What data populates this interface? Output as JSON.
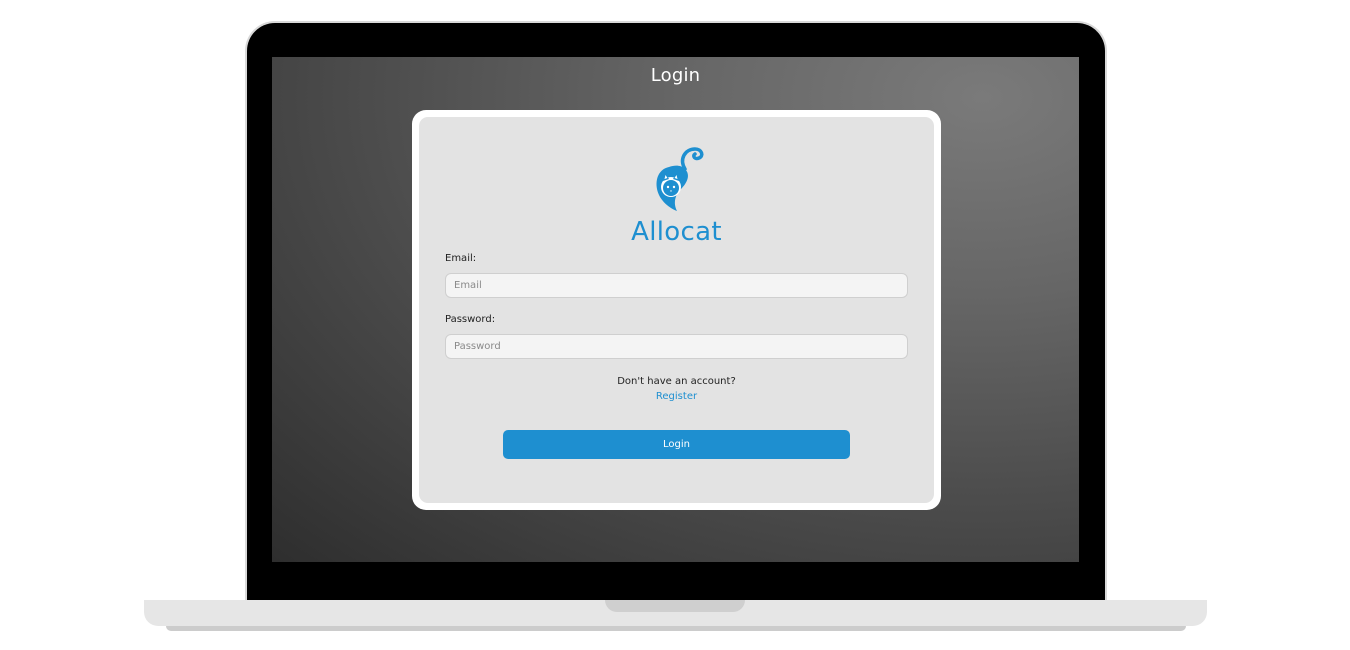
{
  "page": {
    "title": "Login"
  },
  "brand": {
    "name": "Allocat",
    "logo_icon": "cat-logo-icon",
    "color": "#1e8fd0"
  },
  "form": {
    "email_label": "Email:",
    "email_placeholder": "Email",
    "email_value": "",
    "password_label": "Password:",
    "password_placeholder": "Password",
    "password_value": "",
    "no_account_text": "Don't have an account?",
    "register_link": "Register",
    "login_button": "Login"
  },
  "colors": {
    "accent": "#1e8fd0",
    "card_background": "#e3e3e3",
    "screen_background": "#5a5a5a"
  }
}
